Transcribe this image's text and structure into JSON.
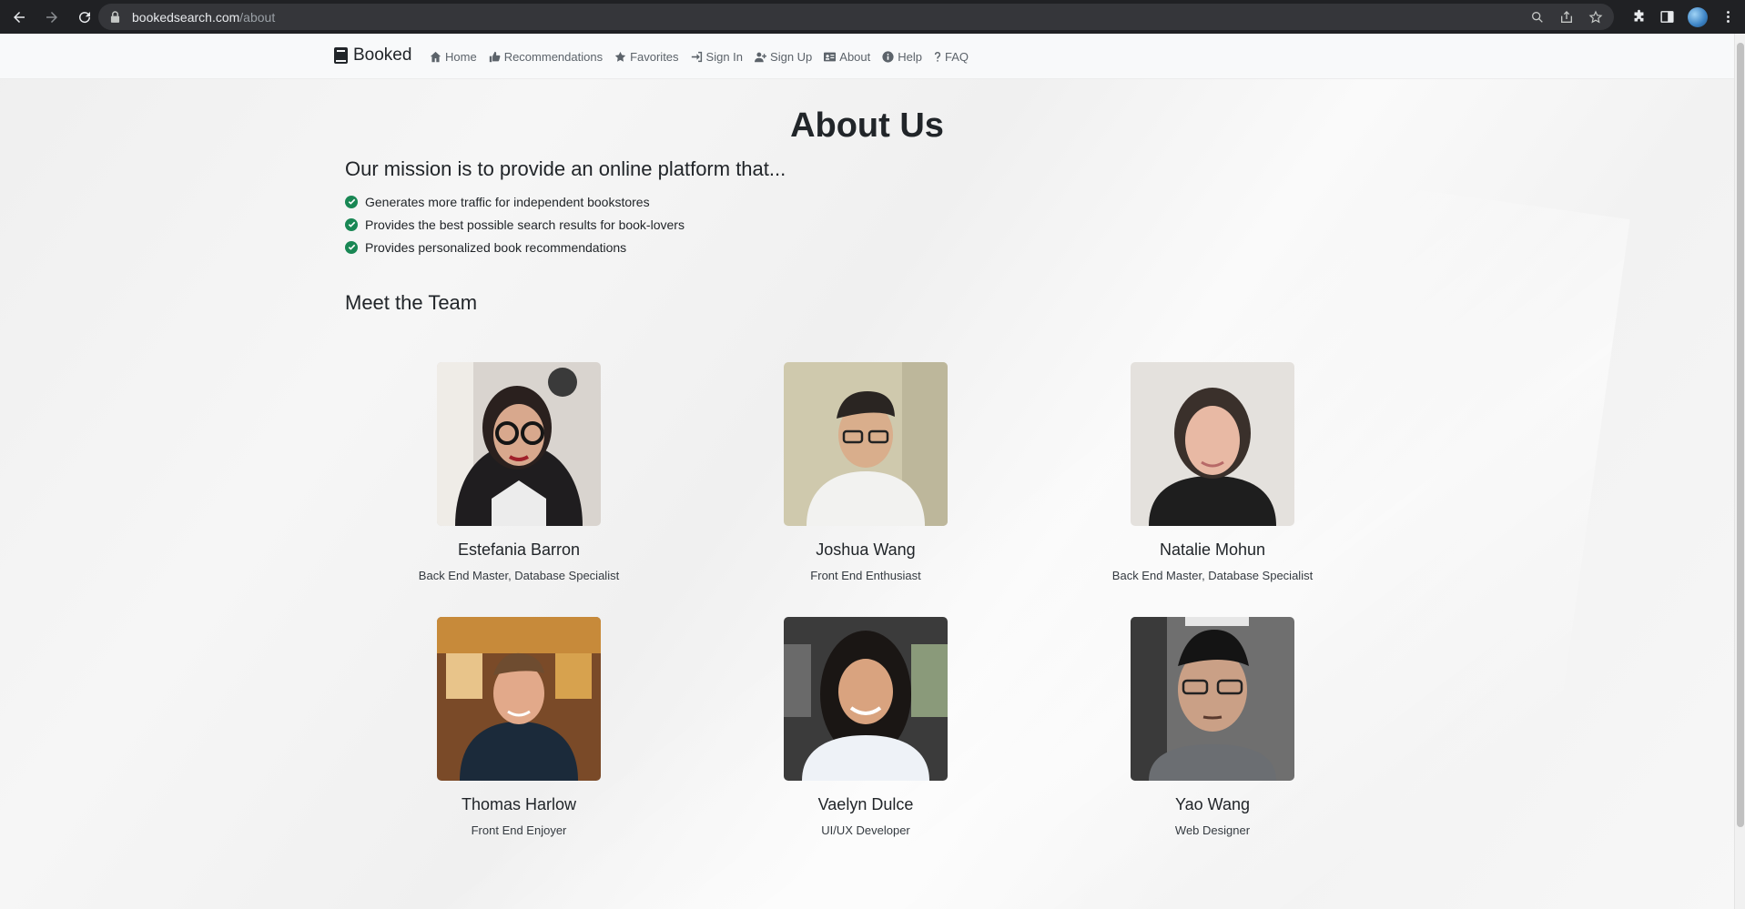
{
  "browser": {
    "url_host": "bookedsearch.com",
    "url_path": "/about"
  },
  "navbar": {
    "brand": "Booked",
    "links": [
      {
        "label": "Home",
        "icon": "home-icon"
      },
      {
        "label": "Recommendations",
        "icon": "thumbs-up-icon"
      },
      {
        "label": "Favorites",
        "icon": "star-icon"
      },
      {
        "label": "Sign In",
        "icon": "sign-in-icon"
      },
      {
        "label": "Sign Up",
        "icon": "user-plus-icon"
      },
      {
        "label": "About",
        "icon": "id-card-icon"
      },
      {
        "label": "Help",
        "icon": "info-circle-icon"
      },
      {
        "label": "FAQ",
        "icon": "question-icon"
      }
    ]
  },
  "main": {
    "title": "About Us",
    "mission_heading": "Our mission is to provide an online platform that...",
    "mission_items": [
      "Generates more traffic for independent bookstores",
      "Provides the best possible search results for book-lovers",
      "Provides personalized book recommendations"
    ],
    "team_heading": "Meet the Team",
    "team": [
      {
        "name": "Estefania Barron",
        "role": "Back End Master, Database Specialist"
      },
      {
        "name": "Joshua Wang",
        "role": "Front End Enthusiast"
      },
      {
        "name": "Natalie Mohun",
        "role": "Back End Master, Database Specialist"
      },
      {
        "name": "Thomas Harlow",
        "role": "Front End Enjoyer"
      },
      {
        "name": "Vaelyn Dulce",
        "role": "UI/UX Developer"
      },
      {
        "name": "Yao Wang",
        "role": "Web Designer"
      }
    ]
  },
  "colors": {
    "check_green": "#198754",
    "navbar_bg": "#f8f9fa",
    "chrome_bg": "#202124"
  }
}
